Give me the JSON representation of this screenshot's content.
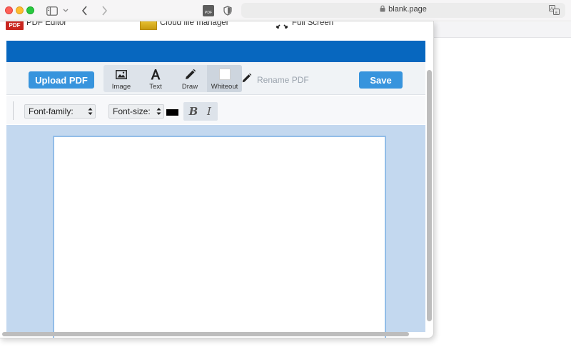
{
  "browser": {
    "url": "blank.page",
    "tab_favicon_text": "PDF"
  },
  "menu": {
    "pdf_editor_logo": "PDF",
    "pdf_editor_label": "PDF Editor",
    "cloud_label": "Cloud file manager",
    "fullscreen_label": "Full Screen"
  },
  "toolbar": {
    "upload_label": "Upload PDF",
    "tools": {
      "image": "Image",
      "text": "Text",
      "draw": "Draw",
      "whiteout": "Whiteout"
    },
    "rename_placeholder": "Rename PDF",
    "save_label": "Save"
  },
  "font_row": {
    "font_family": "Font-family:",
    "font_size": "Font-size:",
    "bold": "B",
    "italic": "I",
    "text_color": "#000000"
  },
  "colors": {
    "header_blue": "#0767bf",
    "button_blue": "#3794dd",
    "canvas_bg": "#c3d8ef",
    "page_border": "#92bde8"
  }
}
